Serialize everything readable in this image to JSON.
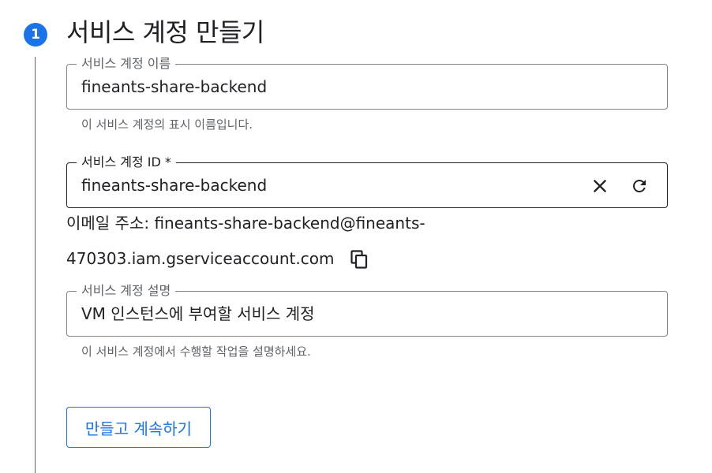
{
  "step": {
    "number": "1",
    "title": "서비스 계정 만들기"
  },
  "fields": {
    "name": {
      "label": "서비스 계정 이름",
      "value": "fineants-share-backend",
      "hint": "이 서비스 계정의 표시 이름입니다."
    },
    "id": {
      "label": "서비스 계정 ID *",
      "value": "fineants-share-backend"
    },
    "description": {
      "label": "서비스 계정 설명",
      "value": "VM 인스턴스에 부여할 서비스 계정",
      "hint": "이 서비스 계정에서 수행할 작업을 설명하세요."
    }
  },
  "email": {
    "line1": "이메일 주소: fineants-share-backend@fineants-",
    "line2": "470303.iam.gserviceaccount.com"
  },
  "icons": {
    "clear": "close-icon",
    "refresh": "refresh-icon",
    "copy": "copy-icon"
  },
  "actions": {
    "create_continue_label": "만들고 계속하기"
  },
  "colors": {
    "accent": "#1a73e8",
    "text": "#202124",
    "muted": "#5f6368",
    "border": "#80868b"
  }
}
